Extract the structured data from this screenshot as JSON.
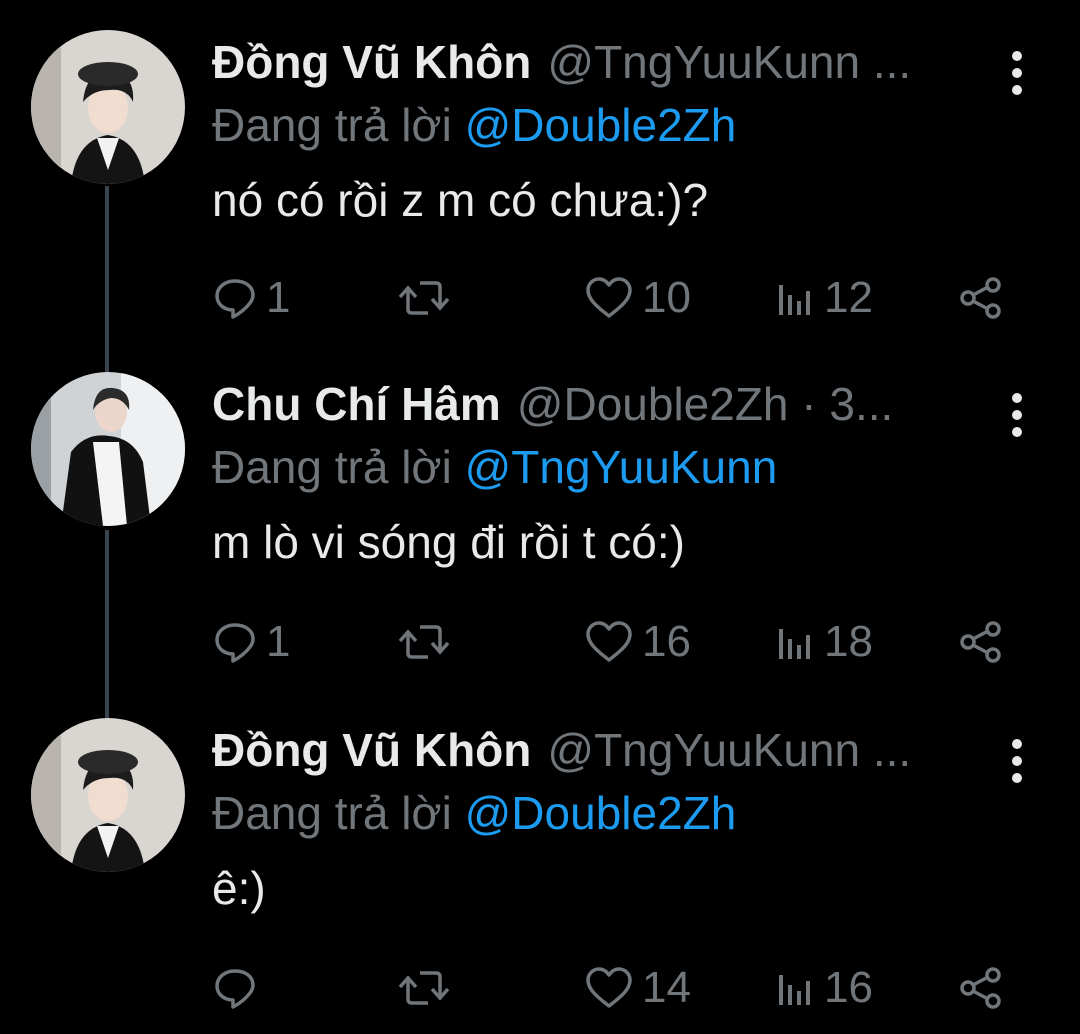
{
  "colors": {
    "background": "#000000",
    "name": "#e7e9ea",
    "muted": "#71767b",
    "mention": "#1d9bf0",
    "thread_line": "#38444d"
  },
  "tweets": [
    {
      "display_name": "Đồng Vũ Khôn",
      "handle_meta": "@TngYuuKunn ...",
      "replying_prefix": "Đang trả lời",
      "replying_to": "@Double2Zh",
      "text": "nó có rồi z m có chưa:)?",
      "replies": "1",
      "retweets": "",
      "likes": "10",
      "views": "12",
      "avatar_icon": "user-avatar"
    },
    {
      "display_name": "Chu Chí Hâm",
      "handle_meta": "@Double2Zh · 3...",
      "replying_prefix": "Đang trả lời",
      "replying_to": "@TngYuuKunn",
      "text": "m lò vi sóng đi rồi t có:)",
      "replies": "1",
      "retweets": "",
      "likes": "16",
      "views": "18",
      "avatar_icon": "user-avatar"
    },
    {
      "display_name": "Đồng Vũ Khôn",
      "handle_meta": "@TngYuuKunn ...",
      "replying_prefix": "Đang trả lời",
      "replying_to": "@Double2Zh",
      "text": "ê:)",
      "replies": "",
      "retweets": "",
      "likes": "14",
      "views": "16",
      "avatar_icon": "user-avatar"
    }
  ],
  "icons": {
    "reply": "comment-icon",
    "retweet": "retweet-icon",
    "like": "heart-icon",
    "views": "views-bar-icon",
    "share": "share-icon",
    "more": "more-vertical-icon"
  }
}
